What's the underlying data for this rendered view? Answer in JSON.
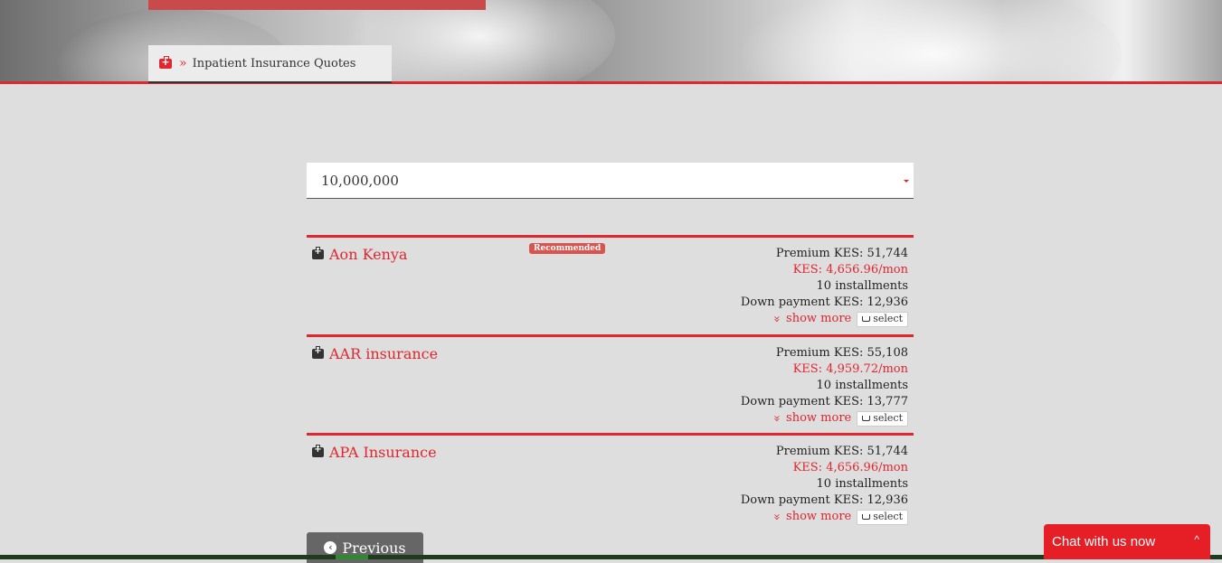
{
  "breadcrumb": {
    "label": "Inpatient Insurance Quotes",
    "icon": "medkit-icon"
  },
  "cover_select": {
    "value": "10,000,000"
  },
  "quotes": [
    {
      "name": "Aon Kenya",
      "badge": "Recommended",
      "premium": "Premium KES: 51,744",
      "monthly": "KES: 4,656.96/mon",
      "installments": "10 installments",
      "down_payment": "Down payment KES: 12,936",
      "show_more": "show more",
      "select": "select"
    },
    {
      "name": "AAR insurance",
      "premium": "Premium KES: 55,108",
      "monthly": "KES: 4,959.72/mon",
      "installments": "10 installments",
      "down_payment": "Down payment KES: 13,777",
      "show_more": "show more",
      "select": "select"
    },
    {
      "name": "APA Insurance",
      "premium": "Premium KES: 51,744",
      "monthly": "KES: 4,656.96/mon",
      "installments": "10 installments",
      "down_payment": "Down payment KES: 12,936",
      "show_more": "show more",
      "select": "select"
    }
  ],
  "nav": {
    "previous": "Previous"
  },
  "chat": {
    "label": "Chat with us now"
  },
  "colors": {
    "accent": "#e0262e",
    "background": "#dedede",
    "badge": "#d9534f",
    "chat": "#e61e25"
  }
}
